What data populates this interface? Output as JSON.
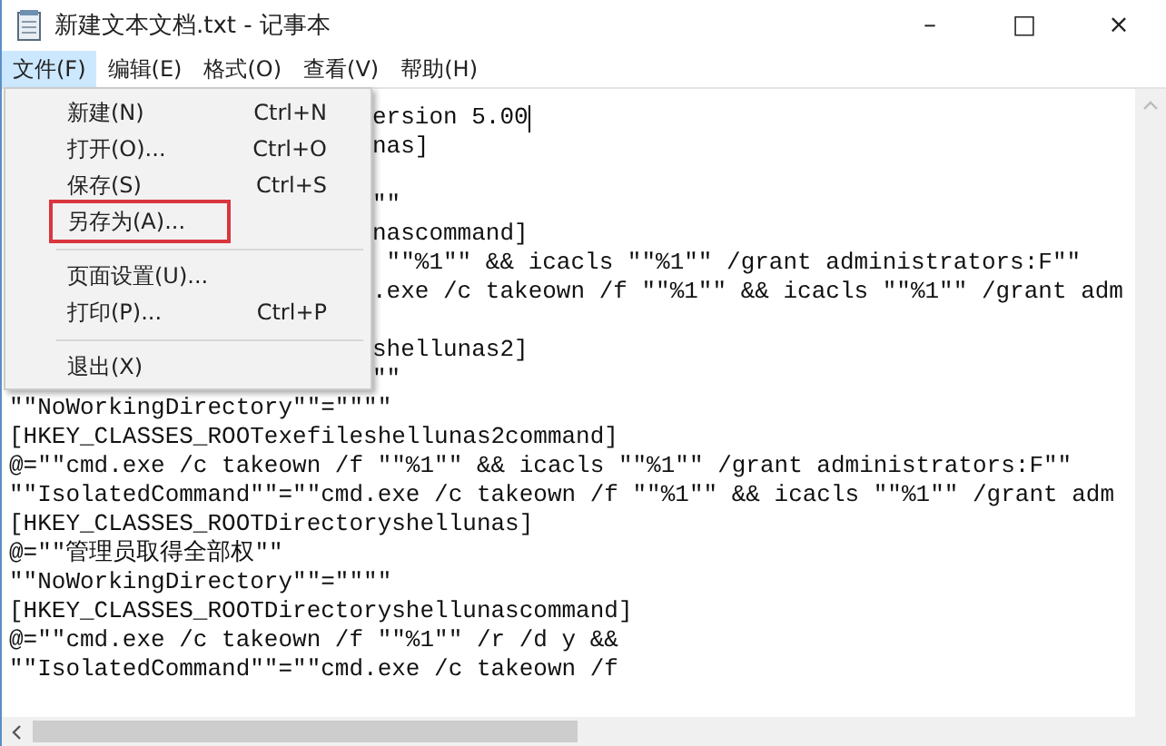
{
  "window": {
    "title": "新建文本文档.txt - 记事本",
    "controls": [
      "–",
      "□",
      "×"
    ]
  },
  "menu_bar": [
    {
      "label": "文件(F)",
      "selected": true
    },
    {
      "label": "编辑(E)",
      "selected": false
    },
    {
      "label": "格式(O)",
      "selected": false
    },
    {
      "label": "查看(V)",
      "selected": false
    },
    {
      "label": "帮助(H)",
      "selected": false
    }
  ],
  "file_menu": [
    {
      "kind": "item",
      "label": "新建(N)",
      "shortcut": "Ctrl+N",
      "highlighted": false
    },
    {
      "kind": "item",
      "label": "打开(O)...",
      "shortcut": "Ctrl+O",
      "highlighted": false
    },
    {
      "kind": "item",
      "label": "保存(S)",
      "shortcut": "Ctrl+S",
      "highlighted": false
    },
    {
      "kind": "item",
      "label": "另存为(A)...",
      "highlighted": true
    },
    {
      "kind": "separator"
    },
    {
      "kind": "item",
      "label": "页面设置(U)...",
      "highlighted": false
    },
    {
      "kind": "item",
      "label": "打印(P)...",
      "shortcut": "Ctrl+P",
      "highlighted": false
    },
    {
      "kind": "separator"
    },
    {
      "kind": "item",
      "label": "退出(X)",
      "highlighted": false
    }
  ],
  "editor": {
    "paragraphs": [
      {
        "lines": [
          {
            "text": "ersion 5.00",
            "partial": true,
            "caret": true
          },
          {
            "text": "nas]",
            "partial": true
          }
        ]
      },
      {
        "lines": [
          {
            "text": "\"\"",
            "partial": true
          },
          {
            "text": "nascommand]",
            "partial": true
          },
          {
            "text": " \"\"%1\"\" && icacls \"\"%1\"\" /grant administrators:F\"\"",
            "partial": true
          },
          {
            "text": ".exe /c takeown /f \"\"%1\"\" && icacls \"\"%1\"\" /grant adm",
            "partial": true
          }
        ]
      },
      {
        "lines": [
          {
            "text": "shellunas2]",
            "partial": true
          },
          {
            "text": "\"\"",
            "partial": true
          },
          {
            "text": "\"\"NoWorkingDirectory\"\"=\"\"\"\"",
            "partial": false
          },
          {
            "text": "[HKEY_CLASSES_ROOTexefileshellunas2command]",
            "partial": false
          },
          {
            "text": "@=\"\"cmd.exe /c takeown /f \"\"%1\"\" && icacls \"\"%1\"\" /grant administrators:F\"\"",
            "partial": false
          },
          {
            "text": "\"\"IsolatedCommand\"\"=\"\"cmd.exe /c takeown /f \"\"%1\"\" && icacls \"\"%1\"\" /grant adm",
            "partial": false
          },
          {
            "text": "[HKEY_CLASSES_ROOTDirectoryshellunas]",
            "partial": false
          },
          {
            "text": "@=\"\"管理员取得全部权\"\"",
            "partial": false
          },
          {
            "text": "\"\"NoWorkingDirectory\"\"=\"\"\"\"",
            "partial": false
          },
          {
            "text": "[HKEY_CLASSES_ROOTDirectoryshellunascommand]",
            "partial": false
          },
          {
            "text": "@=\"\"cmd.exe /c takeown /f \"\"%1\"\" /r /d y &&",
            "partial": false
          },
          {
            "text": "\"\"IsolatedCommand\"\"=\"\"cmd.exe /c takeown /f",
            "partial": false
          }
        ]
      }
    ]
  }
}
